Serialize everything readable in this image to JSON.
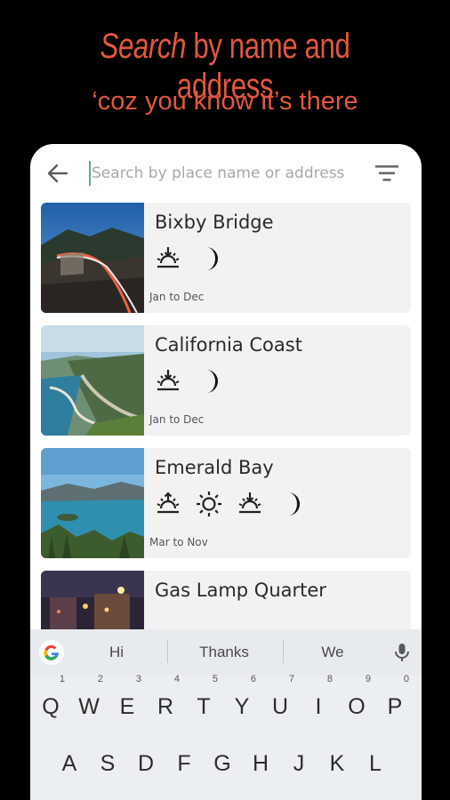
{
  "promo": {
    "title_italic": "Search",
    "title_rest": " by name and address",
    "subtitle": "‘coz you know it’s there"
  },
  "search": {
    "placeholder": "Search by place name or address",
    "value": ""
  },
  "icons": {
    "back": "arrow-back-icon",
    "filter": "filter-list-icon",
    "sunrise": "sunrise-icon",
    "sun": "sun-icon",
    "sunset": "sunset-icon",
    "moon": "moon-icon"
  },
  "places": [
    {
      "name": "Bixby Bridge",
      "icons": [
        "sunset",
        "moon"
      ],
      "season": "Jan to Dec"
    },
    {
      "name": "California Coast",
      "icons": [
        "sunset",
        "moon"
      ],
      "season": "Jan to Dec"
    },
    {
      "name": "Emerald Bay",
      "icons": [
        "sunrise",
        "sun",
        "sunset",
        "moon"
      ],
      "season": "Mar to Nov"
    },
    {
      "name": "Gas Lamp Quarter",
      "icons": [],
      "season": ""
    }
  ],
  "keyboard": {
    "suggestions": [
      "Hi",
      "Thanks",
      "We"
    ],
    "row1": [
      {
        "k": "Q",
        "n": "1"
      },
      {
        "k": "W",
        "n": "2"
      },
      {
        "k": "E",
        "n": "3"
      },
      {
        "k": "R",
        "n": "4"
      },
      {
        "k": "T",
        "n": "5"
      },
      {
        "k": "Y",
        "n": "6"
      },
      {
        "k": "U",
        "n": "7"
      },
      {
        "k": "I",
        "n": "8"
      },
      {
        "k": "O",
        "n": "9"
      },
      {
        "k": "P",
        "n": "0"
      }
    ],
    "row2": [
      "A",
      "S",
      "D",
      "F",
      "G",
      "H",
      "J",
      "K",
      "L"
    ]
  },
  "colors": {
    "accent": "#e2583e",
    "cursor": "#5fa89a"
  }
}
